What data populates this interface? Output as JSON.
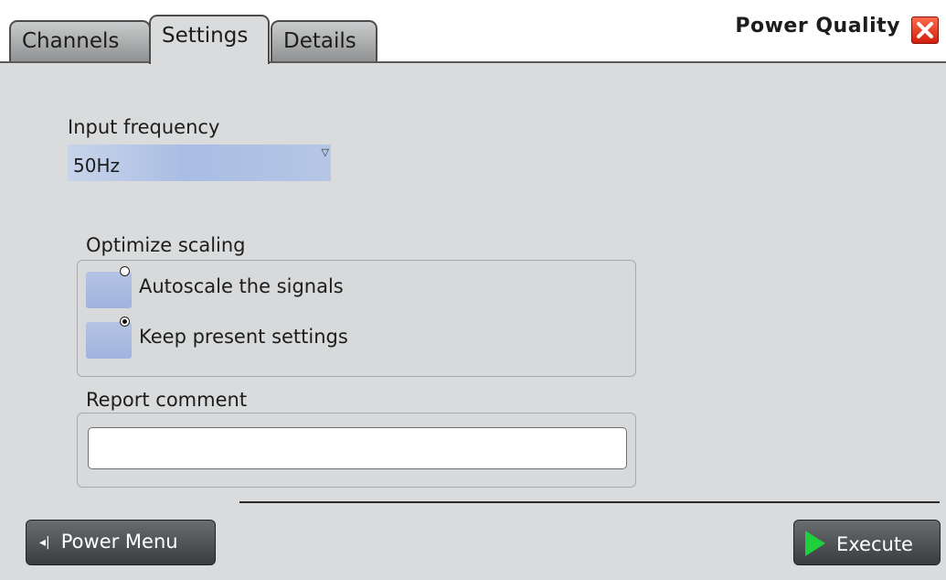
{
  "header": {
    "tabs": [
      {
        "label": "Channels",
        "active": false
      },
      {
        "label": "Settings",
        "active": true
      },
      {
        "label": "Details",
        "active": false
      }
    ],
    "title": "Power Quality",
    "close_icon": "close-icon"
  },
  "settings": {
    "input_frequency": {
      "label": "Input frequency",
      "selected": "50Hz"
    },
    "optimize_scaling": {
      "label": "Optimize scaling",
      "options": [
        {
          "label": "Autoscale the signals",
          "selected": false
        },
        {
          "label": "Keep present settings",
          "selected": true
        }
      ]
    },
    "report_comment": {
      "label": "Report comment",
      "value": ""
    }
  },
  "footer": {
    "power_menu_label": "Power Menu",
    "execute_label": "Execute",
    "colors": {
      "execute_icon": "#1ed13c",
      "close_button": "#e03a1c"
    }
  }
}
